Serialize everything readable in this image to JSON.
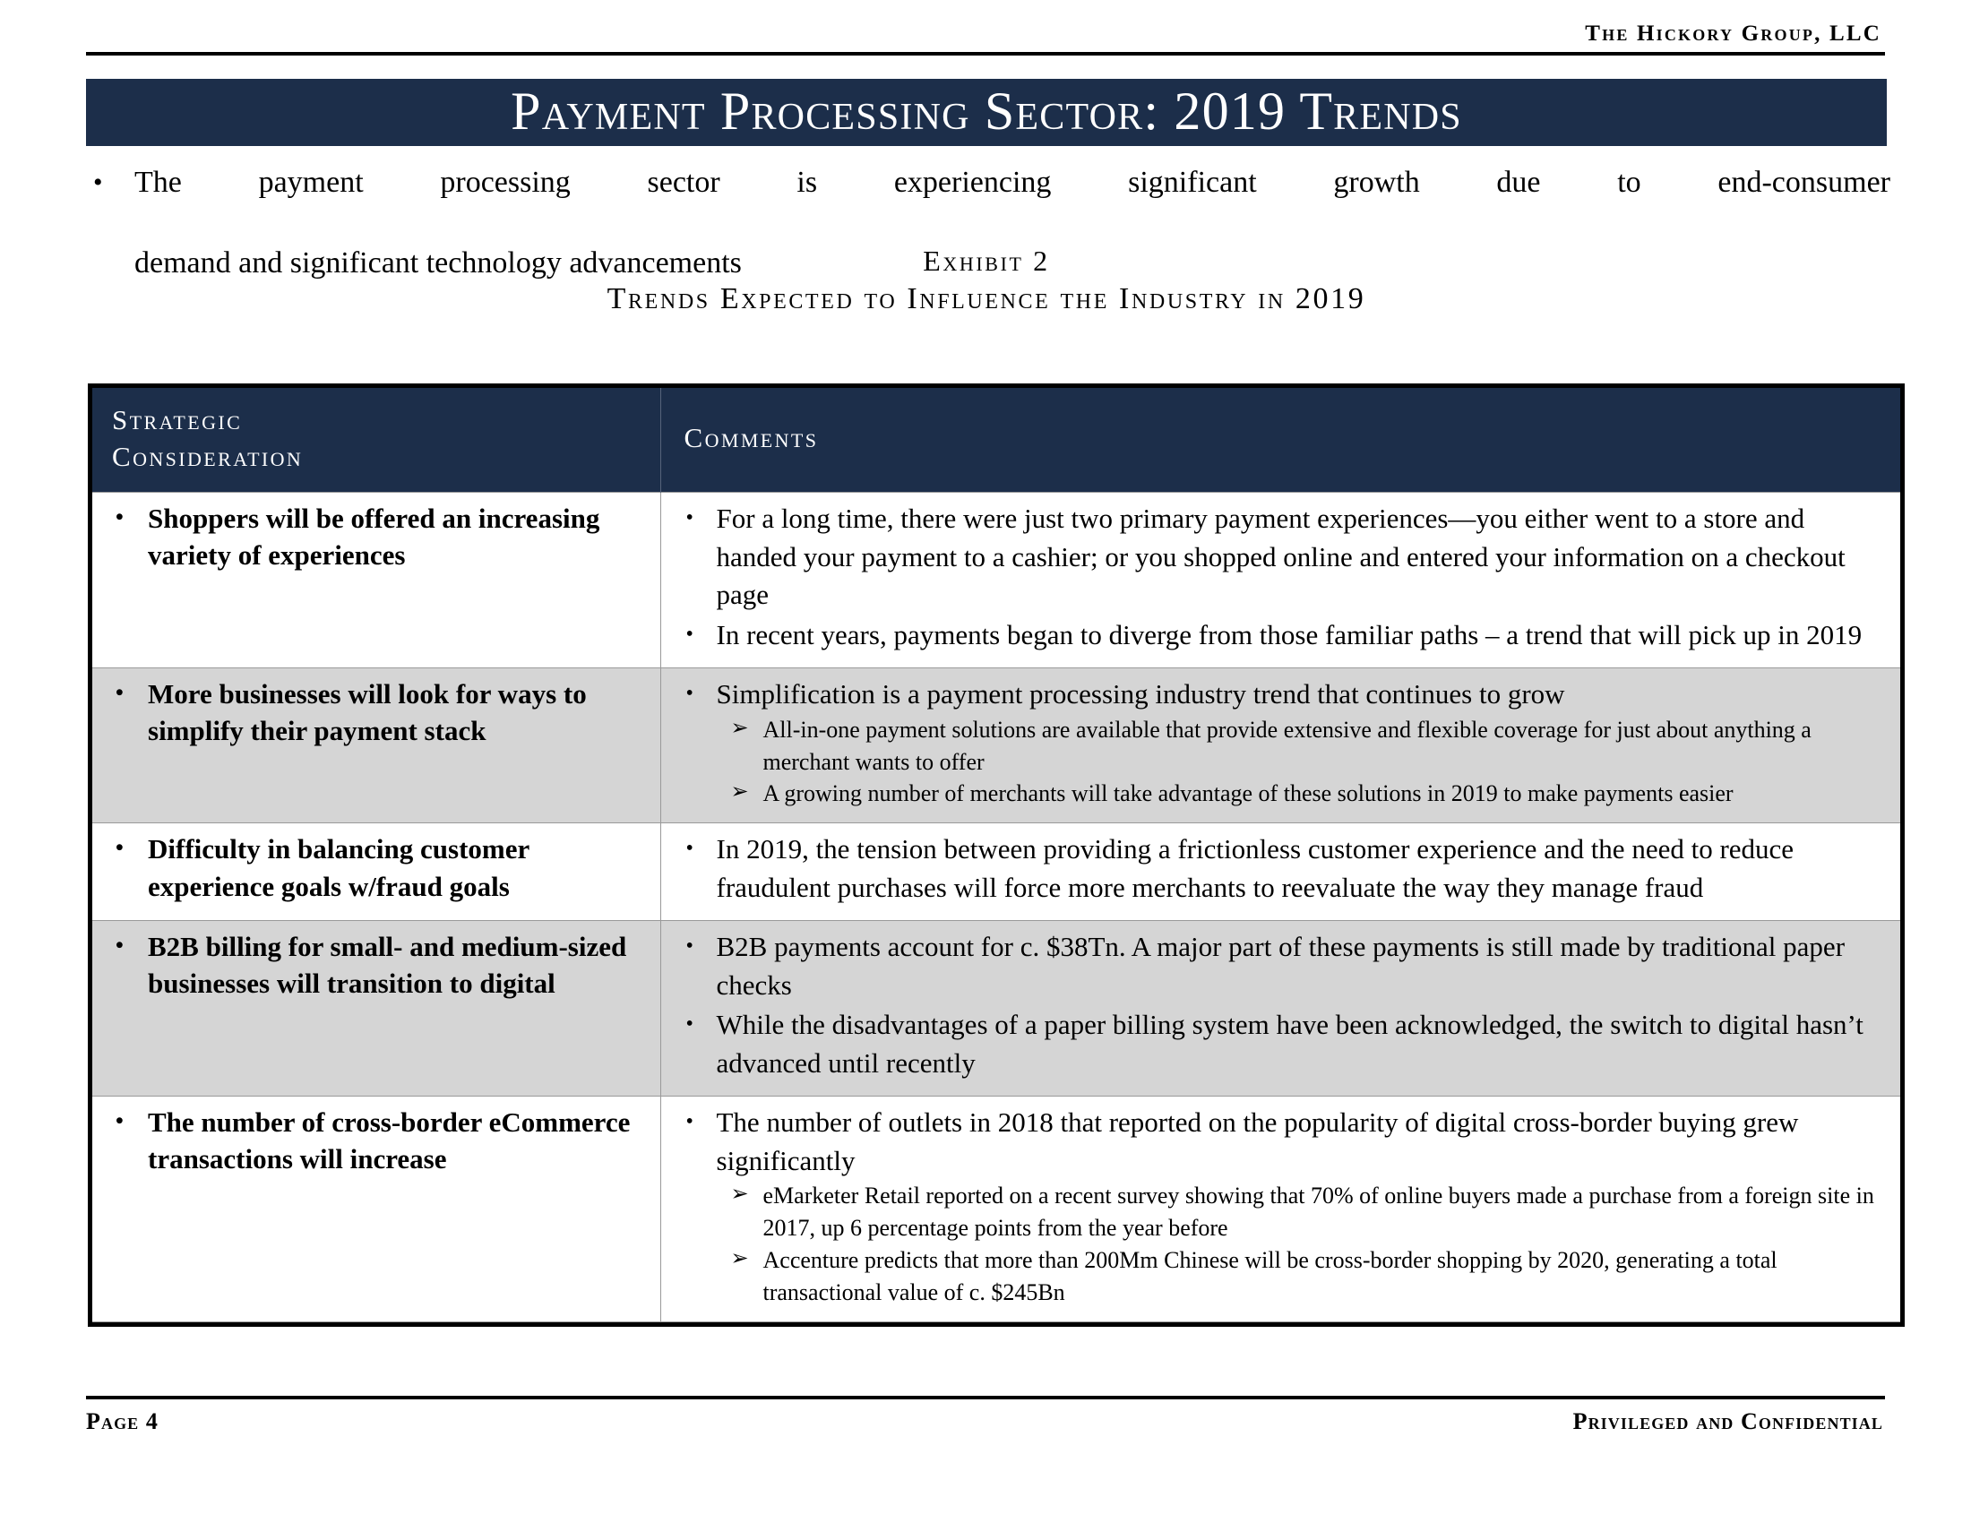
{
  "header": {
    "company": "The Hickory Group, LLC"
  },
  "title_banner": {
    "text": "Payment Processing Sector: 2019 Trends",
    "background_color": "#1c2e4a",
    "text_color": "#ffffff"
  },
  "lead_bullet": {
    "marker": "bullet-dot",
    "line1": "The payment processing sector is experiencing significant growth due to end-consumer",
    "line2": "demand and significant technology advancements"
  },
  "exhibit": {
    "number": "Exhibit 2",
    "title": "Trends Expected to Influence the Industry in 2019"
  },
  "table": {
    "columns": [
      {
        "label_line1": "Strategic",
        "label_line2": "Consideration"
      },
      {
        "label": "Comments"
      }
    ],
    "header_background": "#1c2e4a",
    "shaded_row_background": "#d5d5d5",
    "rows": [
      {
        "shaded": false,
        "consideration": "Shoppers will be offered an increasing variety of experiences",
        "comments": [
          {
            "text": "For a long time, there were just two primary payment experiences—you either went to a store and handed your payment to a cashier; or you shopped online and entered your information on a checkout page",
            "subs": []
          },
          {
            "text": "In recent years, payments began to diverge from those familiar paths – a trend that will pick up in 2019",
            "subs": []
          }
        ]
      },
      {
        "shaded": true,
        "consideration": "More businesses will look for ways to simplify their payment stack",
        "comments": [
          {
            "text": "Simplification is a payment processing industry trend that continues to grow",
            "subs": [
              "All-in-one payment solutions are available that provide extensive and flexible coverage for just about anything a merchant wants to offer",
              "A growing number of merchants will take advantage of these solutions in 2019 to make payments easier"
            ]
          }
        ]
      },
      {
        "shaded": false,
        "consideration": "Difficulty in balancing customer experience goals w/fraud goals",
        "comments": [
          {
            "text": "In 2019, the tension between providing a frictionless customer experience and the need to reduce fraudulent purchases will force more merchants to reevaluate the way they manage fraud",
            "subs": []
          }
        ]
      },
      {
        "shaded": true,
        "consideration": "B2B billing for small- and medium-sized businesses will transition to digital",
        "comments": [
          {
            "text": "B2B payments account for c. $38Tn.  A major part of these payments is still made by traditional paper checks",
            "subs": []
          },
          {
            "text": "While the disadvantages of a paper billing system have been acknowledged, the switch to digital hasn’t advanced until recently",
            "subs": []
          }
        ]
      },
      {
        "shaded": false,
        "consideration": "The number of cross-border eCommerce transactions will increase",
        "comments": [
          {
            "text": "The number of outlets in 2018 that reported on the popularity of digital cross-border buying grew significantly",
            "subs": [
              "eMarketer Retail reported on a recent survey showing that 70% of online buyers made a purchase from a foreign site in 2017, up 6 percentage points from the year before",
              "Accenture predicts that more than 200Mm Chinese will be cross-border shopping by 2020, generating a total transactional value of c. $245Bn"
            ]
          }
        ]
      }
    ]
  },
  "footer": {
    "page_label": "Page 4",
    "classification": "Privileged and Confidential"
  },
  "markers": {
    "bullet": "•",
    "sub_bullet": "➢"
  }
}
